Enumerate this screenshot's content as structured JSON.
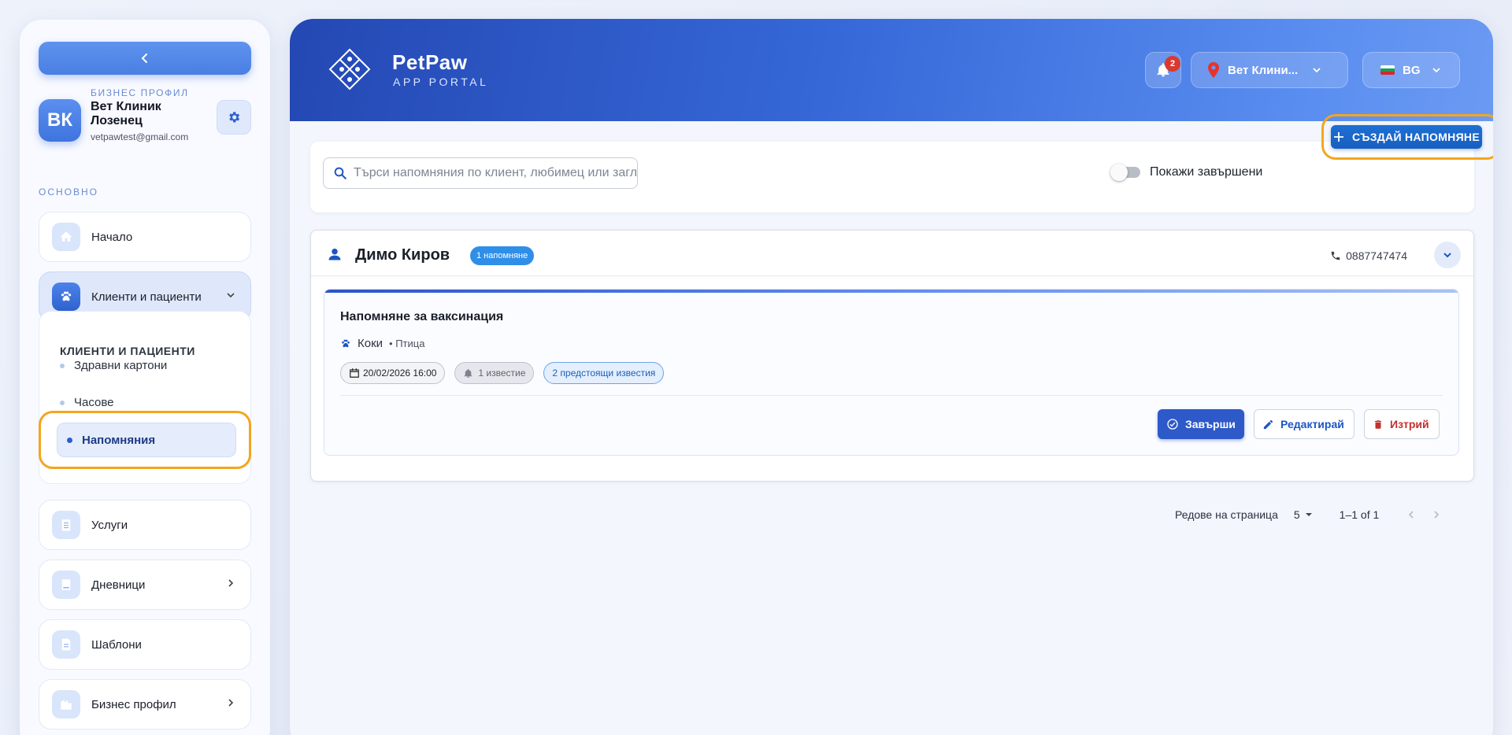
{
  "sidebar": {
    "profile": {
      "initials": "ВК",
      "caption": "БИЗНЕС ПРОФИЛ",
      "name": "Вет Клиник Лозенец",
      "email": "vetpawtest@gmail.com"
    },
    "section_label": "ОСНОВНО",
    "items": [
      {
        "label": "Начало",
        "icon": "home-icon"
      },
      {
        "label": "Клиенти и пациенти",
        "icon": "paw-icon"
      },
      {
        "label": "Услуги",
        "icon": "clipboard-icon"
      },
      {
        "label": "Дневници",
        "icon": "book-icon"
      },
      {
        "label": "Шаблони",
        "icon": "document-icon"
      },
      {
        "label": "Бизнес профил",
        "icon": "building-icon"
      }
    ],
    "submenu": {
      "title": "КЛИЕНТИ И ПАЦИЕНТИ",
      "items": [
        "Здравни картони",
        "Часове",
        "Напомняния"
      ],
      "active": "Напомняния"
    }
  },
  "header": {
    "brand": "PetPaw",
    "brand_sub": "APP PORTAL",
    "notifications_count": "2",
    "clinic": "Вет Клини...",
    "language": "BG"
  },
  "toolbar": {
    "search_placeholder": "Търси напомняния по клиент, любимец или заглавие",
    "toggle_label": "Покажи завършени",
    "toggle_on": false,
    "create_label": "СЪЗДАЙ НАПОМНЯНЕ"
  },
  "clients": [
    {
      "name": "Димо Киров",
      "count_label": "1 напомняне",
      "phone": "0887747474",
      "reminders": [
        {
          "title": "Напомняне за ваксинация",
          "pet": "Коки",
          "species": "• Птица",
          "datetime": "20/02/2026 16:00",
          "notifications": "1 известие",
          "upcoming": "2 предстоящи известия",
          "actions": {
            "complete": "Завърши",
            "edit": "Редактирай",
            "delete": "Изтрий"
          }
        }
      ]
    }
  ],
  "pagination": {
    "rows_label": "Редове на страница",
    "rows_value": "5",
    "range": "1–1 of 1"
  },
  "colors": {
    "accent": "#2d59c9",
    "highlight": "#f4a51d",
    "danger": "#c53030"
  }
}
